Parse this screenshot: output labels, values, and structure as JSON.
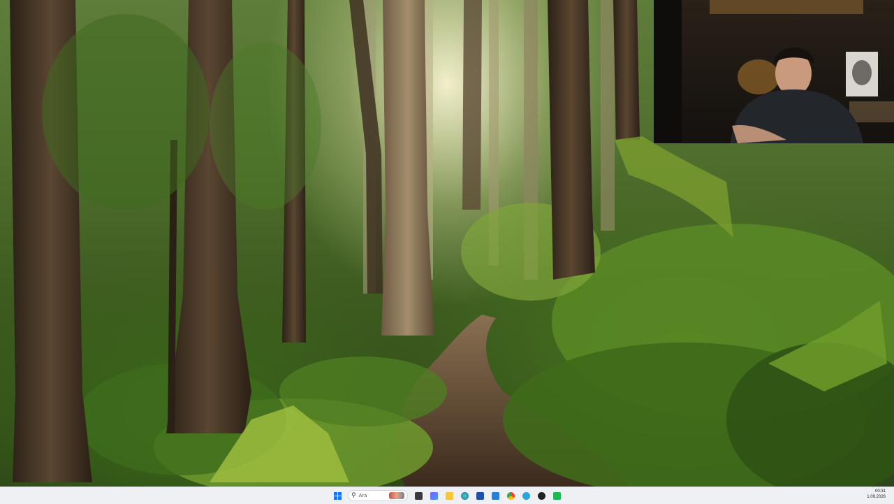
{
  "desktop": {
    "wallpaper": "forest-trail-wallpaper"
  },
  "webcam": {
    "description_icon": "presenter-webcam-feed"
  },
  "taskbar": {
    "search_placeholder": "Ara",
    "apps": [
      {
        "icon": "start-icon"
      },
      {
        "icon": "search-icon"
      },
      {
        "icon": "task-view-icon"
      },
      {
        "icon": "widgets-icon"
      },
      {
        "icon": "file-explorer-icon"
      },
      {
        "icon": "edge-icon"
      },
      {
        "icon": "store-icon"
      },
      {
        "icon": "mail-icon"
      },
      {
        "icon": "chrome-icon"
      },
      {
        "icon": "telegram-icon"
      },
      {
        "icon": "obs-icon"
      },
      {
        "icon": "app-green-icon"
      }
    ],
    "clock_time": "00:31",
    "clock_date": "1.09.2026"
  },
  "colors": {
    "accent": "#1a73e8",
    "taskbar_bg": "#eef0f3"
  }
}
